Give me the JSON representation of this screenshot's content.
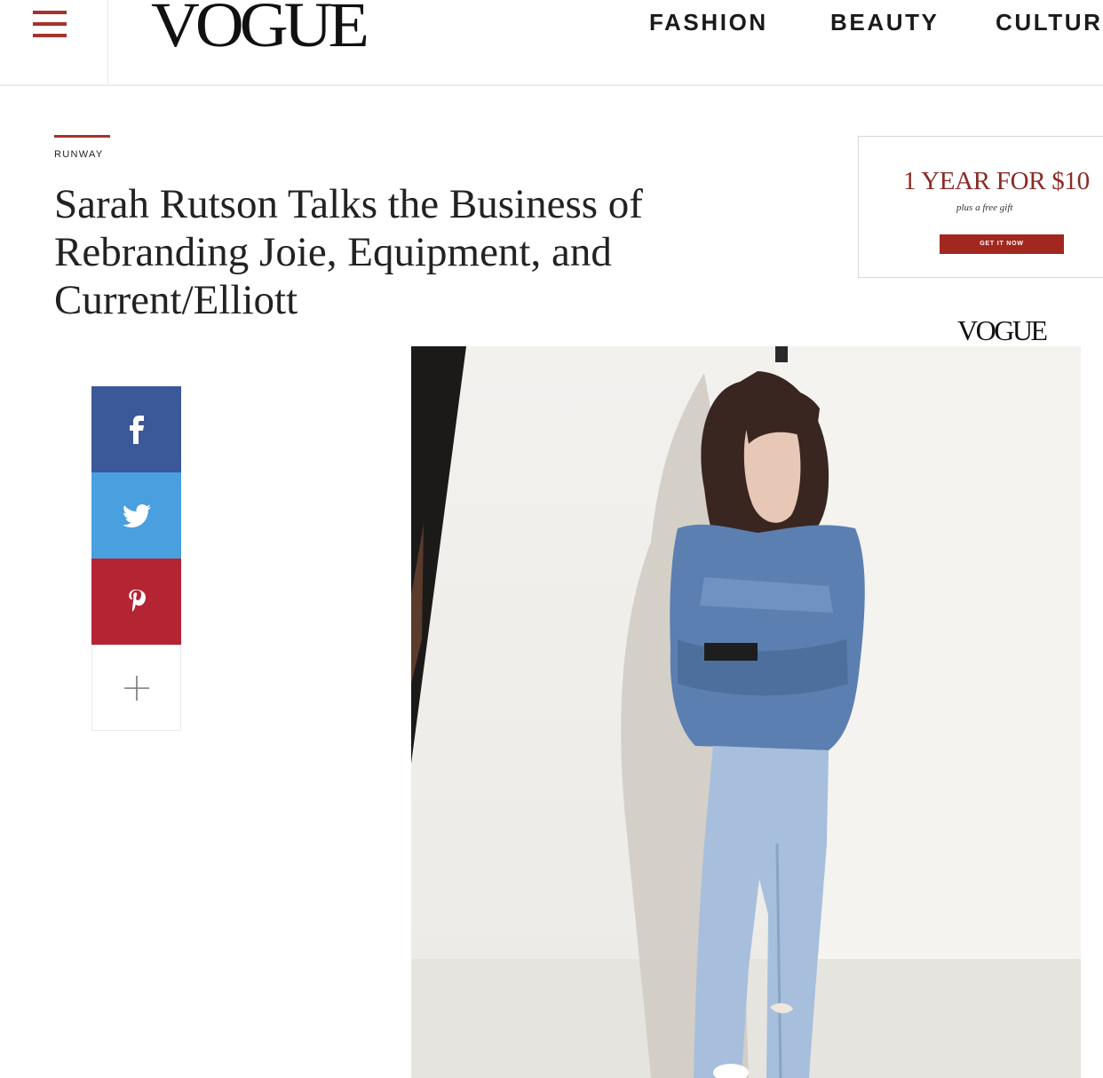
{
  "header": {
    "logo": "VOGUE",
    "nav": [
      {
        "label": "FASHION"
      },
      {
        "label": "BEAUTY"
      },
      {
        "label": "CULTUR"
      }
    ]
  },
  "article": {
    "category": "RUNWAY",
    "headline": "Sarah Rutson Talks the Business of Rebranding Joie, Equipment, and Current/Elliott"
  },
  "ad": {
    "title": "1 YEAR FOR $10",
    "subtitle": "plus a free gift",
    "button": "GET IT NOW",
    "logo": "VOGUE"
  },
  "share": {
    "facebook_icon": "facebook-icon",
    "twitter_icon": "twitter-icon",
    "pinterest_icon": "pinterest-icon",
    "more_icon": "plus-icon"
  },
  "colors": {
    "accent": "#a6332c",
    "facebook": "#3b5998",
    "twitter": "#4a9fdf",
    "pinterest": "#b52432"
  }
}
